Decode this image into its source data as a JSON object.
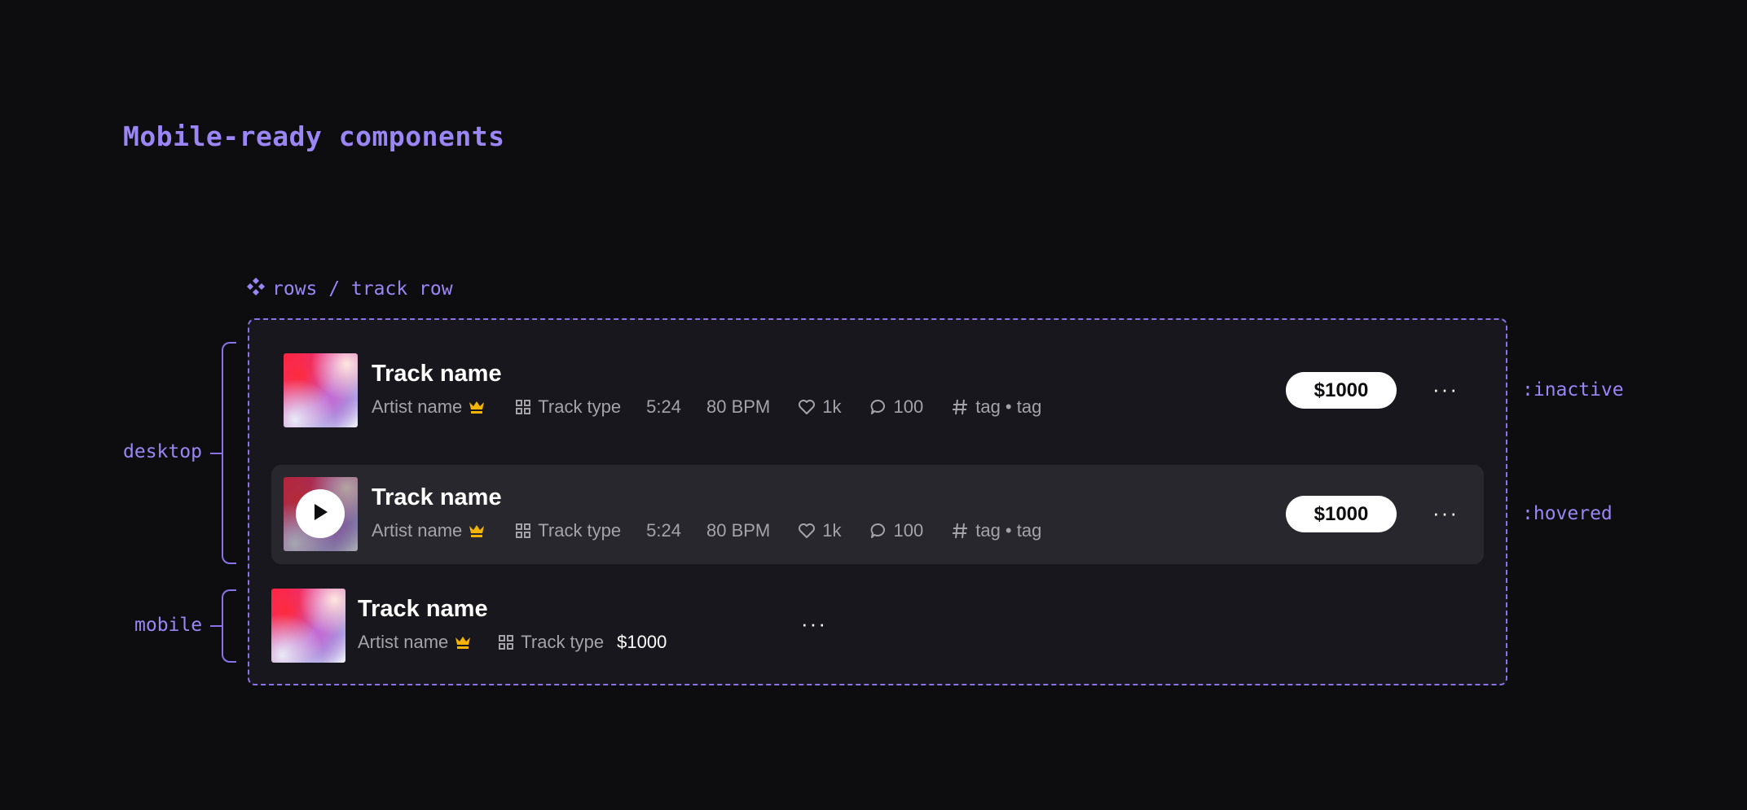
{
  "page": {
    "title": "Mobile-ready components"
  },
  "component": {
    "label": "rows / track row",
    "icon": "component-icon"
  },
  "groups": {
    "desktop": "desktop",
    "mobile": "mobile"
  },
  "states": {
    "inactive": ":inactive",
    "hovered": ":hovered"
  },
  "rows": [
    {
      "variant": "desktop-inactive",
      "title": "Track name",
      "artist": "Artist name",
      "track_type": "Track type",
      "duration": "5:24",
      "bpm": "80 BPM",
      "likes": "1k",
      "comments": "100",
      "tags": "tag • tag",
      "price": "$1000",
      "more": "···"
    },
    {
      "variant": "desktop-hovered",
      "title": "Track name",
      "artist": "Artist name",
      "track_type": "Track type",
      "duration": "5:24",
      "bpm": "80 BPM",
      "likes": "1k",
      "comments": "100",
      "tags": "tag • tag",
      "price": "$1000",
      "more": "···"
    },
    {
      "variant": "mobile",
      "title": "Track name",
      "artist": "Artist name",
      "track_type": "Track type",
      "price": "$1000",
      "more": "···"
    }
  ],
  "colors": {
    "accent": "#9b86f5",
    "crown": "#f5b400",
    "background": "#0d0d10",
    "frame": "#18171d",
    "hover_row": "#28272d"
  }
}
